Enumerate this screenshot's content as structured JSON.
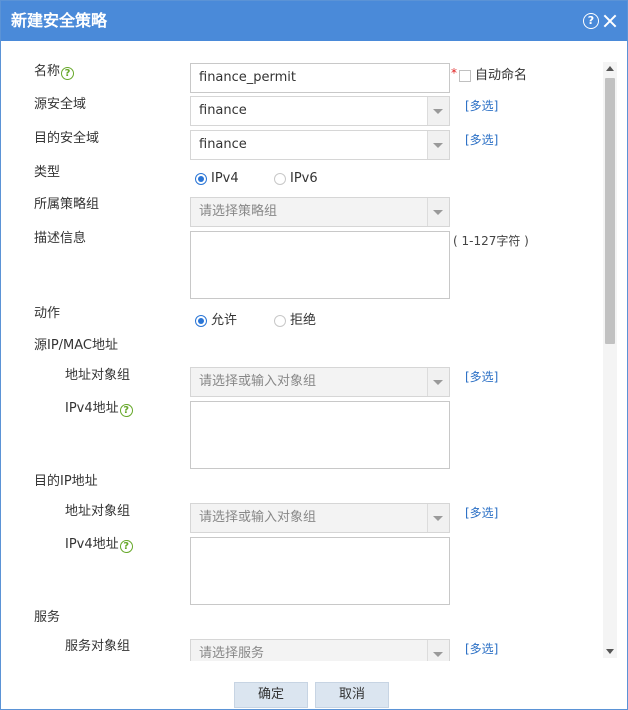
{
  "dialog": {
    "title": "新建安全策略",
    "help_icon_glyph": "?"
  },
  "form": {
    "name": {
      "label": "名称",
      "value": "finance_permit",
      "required_mark": "*",
      "auto_name_label": "自动命名",
      "auto_name_checked": false
    },
    "src_zone": {
      "label": "源安全域",
      "value": "finance",
      "multi_select": "[多选]"
    },
    "dst_zone": {
      "label": "目的安全域",
      "value": "finance",
      "multi_select": "[多选]"
    },
    "type": {
      "label": "类型",
      "options": [
        "IPv4",
        "IPv6"
      ],
      "selected": "IPv4"
    },
    "policy_group": {
      "label": "所属策略组",
      "placeholder": "请选择策略组"
    },
    "description": {
      "label": "描述信息",
      "hint": "( 1-127字符 )",
      "value": ""
    },
    "action": {
      "label": "动作",
      "options": [
        "允许",
        "拒绝"
      ],
      "selected": "允许"
    },
    "src_addr": {
      "section_label": "源IP/MAC地址",
      "obj_group_label": "地址对象组",
      "obj_group_placeholder": "请选择或输入对象组",
      "multi_select": "[多选]",
      "ipv4_label": "IPv4地址"
    },
    "dst_addr": {
      "section_label": "目的IP地址",
      "obj_group_label": "地址对象组",
      "obj_group_placeholder": "请选择或输入对象组",
      "multi_select": "[多选]",
      "ipv4_label": "IPv4地址"
    },
    "service": {
      "section_label": "服务",
      "obj_group_label": "服务对象组",
      "obj_group_placeholder": "请选择服务",
      "multi_select": "[多选]"
    }
  },
  "footer": {
    "ok_label": "确定",
    "cancel_label": "取消"
  },
  "colors": {
    "titlebar": "#4a8ad9",
    "link": "#2a6fc5",
    "radio_on": "#2a75d6",
    "help_green": "#67a82a",
    "required": "#e02020"
  },
  "icons": {
    "help": "question-circle-icon",
    "close": "close-icon",
    "field_help": "green-question-icon"
  }
}
